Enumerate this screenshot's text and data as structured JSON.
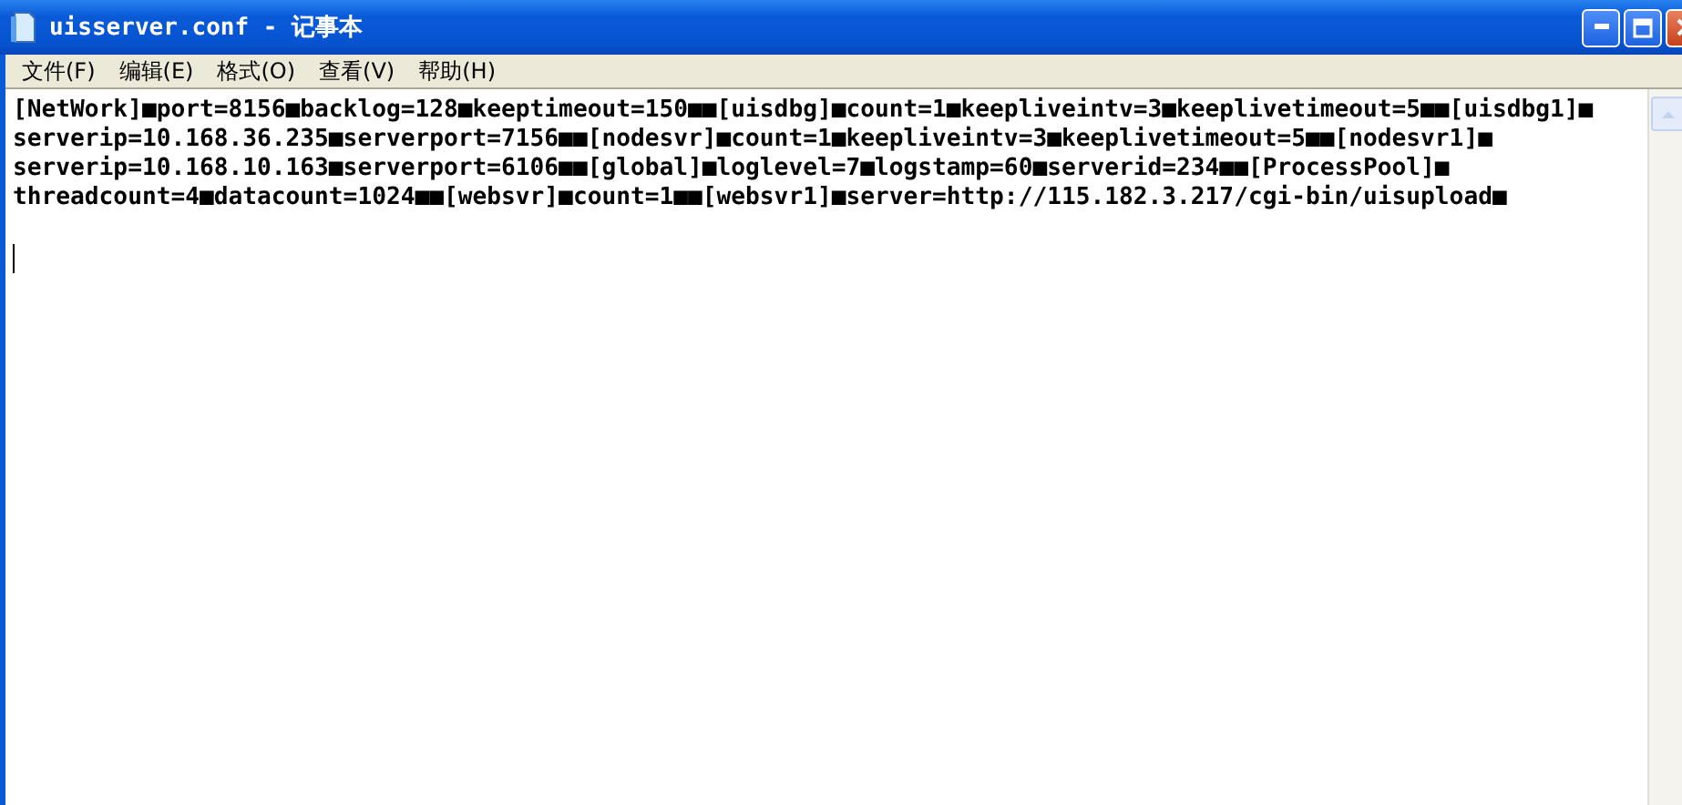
{
  "window": {
    "title": "uisserver.conf - 记事本"
  },
  "menu": [
    {
      "label": "文件(F)"
    },
    {
      "label": "编辑(E)"
    },
    {
      "label": "格式(O)"
    },
    {
      "label": "查看(V)"
    },
    {
      "label": "帮助(H)"
    }
  ],
  "editor": {
    "lines": [
      "[NetWork]■port=8156■backlog=128■keeptimeout=150■■[uisdbg]■count=1■keepliveintv=3■keeplivetimeout=5■■[uisdbg1]■",
      "serverip=10.168.36.235■serverport=7156■■[nodesvr]■count=1■keepliveintv=3■keeplivetimeout=5■■[nodesvr1]■",
      "serverip=10.168.10.163■serverport=6106■■[global]■loglevel=7■logstamp=60■serverid=234■■[ProcessPool]■",
      "threadcount=4■datacount=1024■■[websvr]■count=1■■[websvr1]■server=http://115.182.3.217/cgi-bin/uisupload■"
    ]
  }
}
